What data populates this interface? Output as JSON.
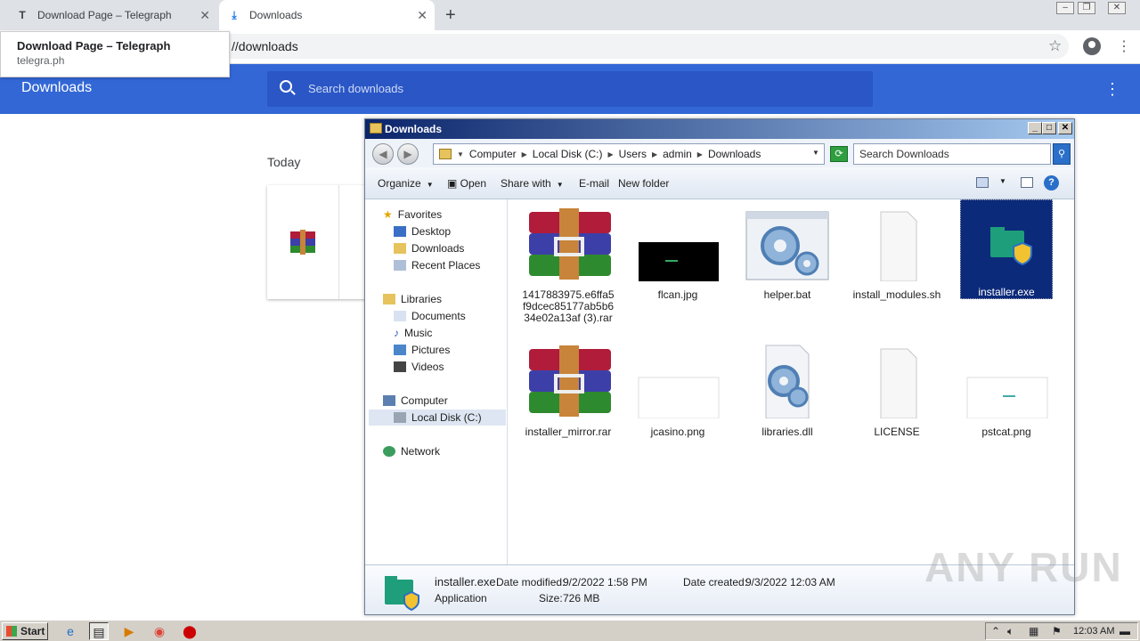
{
  "browser": {
    "tabs": [
      {
        "title": "Download Page – Telegraph",
        "favicon": "T"
      },
      {
        "title": "Downloads"
      }
    ],
    "new_tab": "+",
    "address": "//downloads",
    "tooltip": {
      "title": "Download Page – Telegraph",
      "url": "telegra.ph"
    }
  },
  "downloads_page": {
    "title": "Downloads",
    "search_placeholder": "Search downloads",
    "section": "Today"
  },
  "explorer": {
    "title": "Downloads",
    "breadcrumb": [
      "Computer",
      "Local Disk (C:)",
      "Users",
      "admin",
      "Downloads"
    ],
    "search_placeholder": "Search Downloads",
    "commands": {
      "organize": "Organize",
      "open": "Open",
      "share_with": "Share with",
      "email": "E-mail",
      "new_folder": "New folder"
    },
    "nav": {
      "favorites": "Favorites",
      "desktop": "Desktop",
      "downloads": "Downloads",
      "recent_places": "Recent Places",
      "libraries": "Libraries",
      "documents": "Documents",
      "music": "Music",
      "pictures": "Pictures",
      "videos": "Videos",
      "computer": "Computer",
      "local_disk": "Local Disk (C:)",
      "network": "Network"
    },
    "files": [
      {
        "name": "1417883975.e6ffa5f9dcec85177ab5b634e02a13af (3).rar",
        "type": "rar"
      },
      {
        "name": "flcan.jpg",
        "type": "image-dark"
      },
      {
        "name": "helper.bat",
        "type": "bat"
      },
      {
        "name": "install_modules.sh",
        "type": "blank"
      },
      {
        "name": "installer.exe",
        "type": "exe",
        "selected": true
      },
      {
        "name": "installer_mirror.rar",
        "type": "rar"
      },
      {
        "name": "jcasino.png",
        "type": "image-light"
      },
      {
        "name": "libraries.dll",
        "type": "dll"
      },
      {
        "name": "LICENSE",
        "type": "blank"
      },
      {
        "name": "pstcat.png",
        "type": "image-light"
      }
    ],
    "status": {
      "name": "installer.exe",
      "kind": "Application",
      "modified_label": "Date modified:",
      "modified": "9/2/2022 1:58 PM",
      "created_label": "Date created:",
      "created": "9/3/2022 12:03 AM",
      "size_label": "Size:",
      "size": "726 MB"
    }
  },
  "taskbar": {
    "start": "Start",
    "clock": "12:03 AM"
  },
  "watermark": "ANY RUN"
}
